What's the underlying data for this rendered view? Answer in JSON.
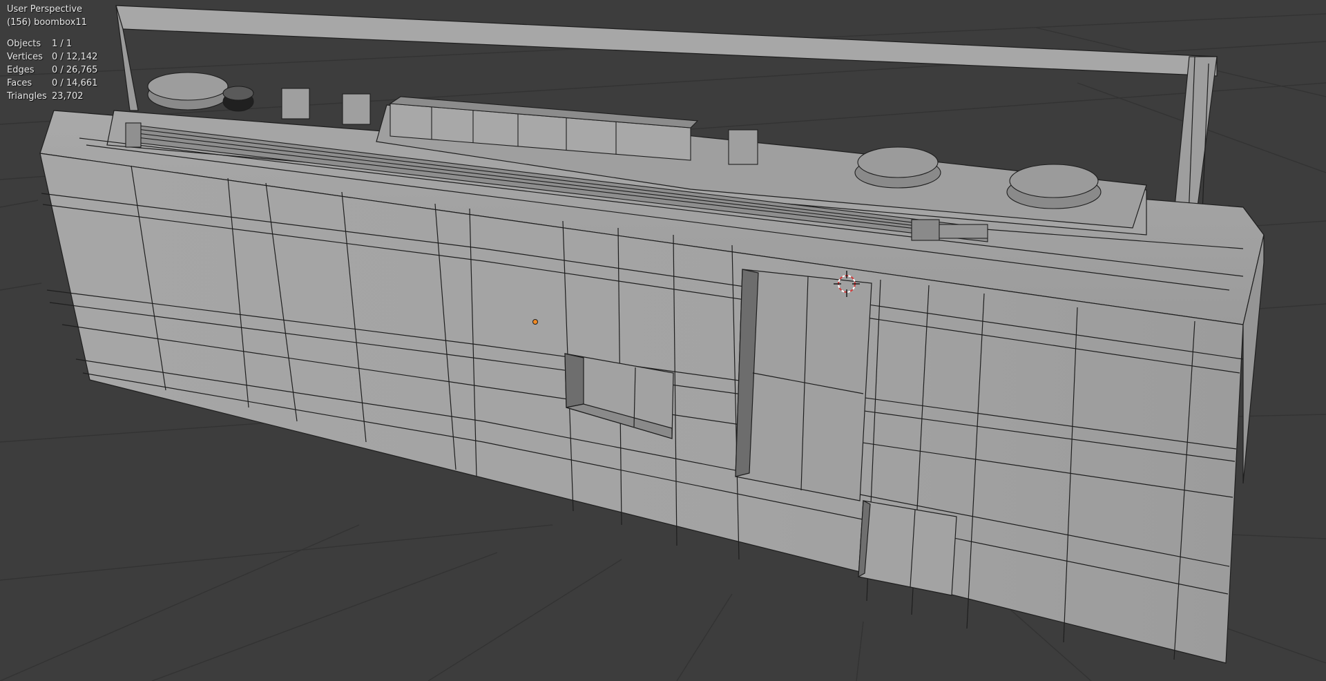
{
  "viewport": {
    "view_name": "User Perspective",
    "object_info": "(156) boombox11",
    "stats": [
      {
        "label": "Objects",
        "value": "1 / 1"
      },
      {
        "label": "Vertices",
        "value": "0 / 12,142"
      },
      {
        "label": "Edges",
        "value": "0 / 26,765"
      },
      {
        "label": "Faces",
        "value": "0 / 14,661"
      },
      {
        "label": "Triangles",
        "value": "23,702"
      }
    ]
  },
  "colors": {
    "background": "#3d3d3d",
    "grid": "#333333",
    "mesh_face": "#a2a2a2",
    "mesh_wire": "#1e1e1e",
    "origin_point": "#f08a24",
    "cursor_red": "#d23a3a"
  },
  "icons": [
    "3d-cursor-icon",
    "origin-point-icon"
  ]
}
